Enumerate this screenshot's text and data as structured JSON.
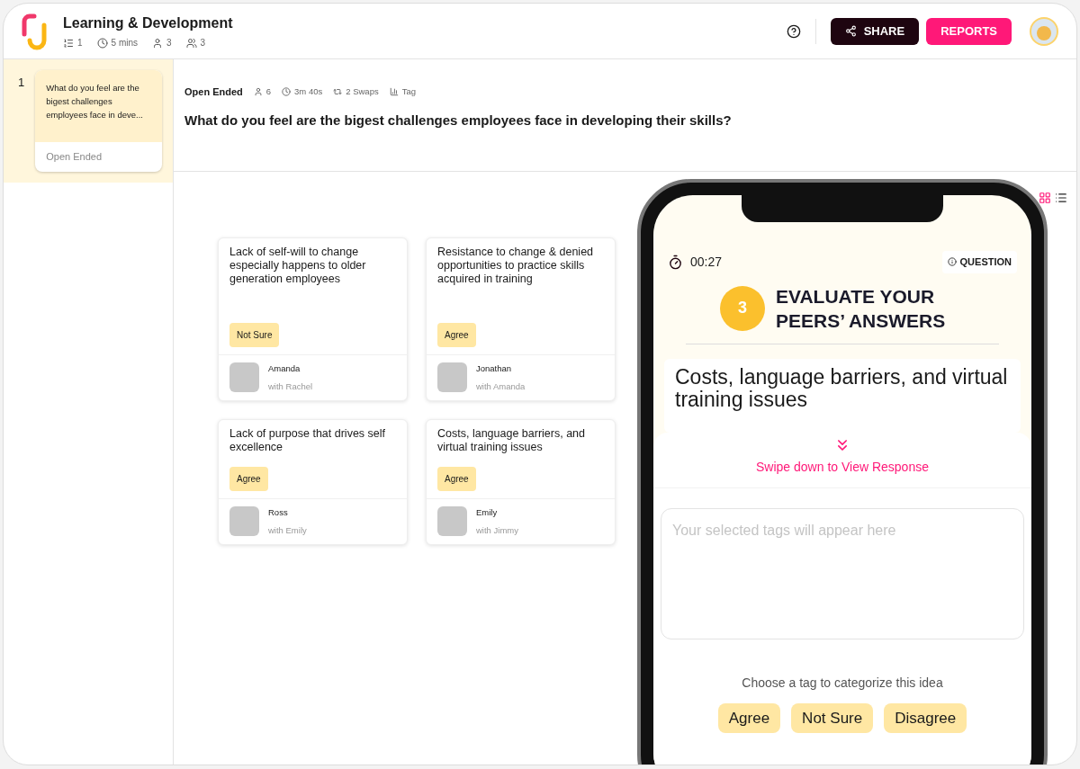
{
  "header": {
    "title": "Learning & Development",
    "stats": [
      {
        "kind": "questions",
        "text": "1"
      },
      {
        "kind": "duration",
        "text": "5 mins"
      },
      {
        "kind": "participants",
        "text": "3"
      },
      {
        "kind": "groups",
        "text": "3"
      }
    ],
    "share_label": "SHARE",
    "reports_label": "REPORTS"
  },
  "sidebar": {
    "items": [
      {
        "number": "1",
        "preview": "What do you feel are the bigest challenges employees face in deve...",
        "type": "Open Ended",
        "selected": true
      }
    ]
  },
  "question": {
    "type": "Open Ended",
    "meta": [
      {
        "kind": "participants",
        "text": "6"
      },
      {
        "kind": "duration",
        "text": "3m 40s"
      },
      {
        "kind": "swaps",
        "text": "2 Swaps"
      },
      {
        "kind": "tag",
        "text": "Tag"
      }
    ],
    "text": "What do you feel are the bigest challenges employees face in developing their skills?"
  },
  "view_toggle": [
    {
      "kind": "grid",
      "selected": true
    },
    {
      "kind": "list",
      "selected": false
    }
  ],
  "responses": [
    {
      "text": "Lack of self-will to change especially happens to older generation employees",
      "tag": "Not Sure",
      "author": "Amanda",
      "partner": "with Rachel"
    },
    {
      "text": "Resistance to change & denied opportunities to practice skills acquired in training",
      "tag": "Agree",
      "author": "Jonathan",
      "partner": "with Amanda"
    },
    {
      "text": "Lack of purpose that drives self excellence",
      "tag": "Agree",
      "author": "Ross",
      "partner": "with Emily"
    },
    {
      "text": "Costs, language barriers, and virtual training issues",
      "tag": "Agree",
      "author": "Emily",
      "partner": "with Jimmy"
    }
  ],
  "phone": {
    "timer": "00:27",
    "question_badge": "QUESTION",
    "step": "3",
    "step_title": "EVALUATE YOUR PEERS’ ANSWERS",
    "answer": "Costs, language barriers, and virtual training issues",
    "swipe_hint": "Swipe down to View Response",
    "tags_placeholder": "Your selected tags will appear here",
    "tag_prompt": "Choose a tag to categorize this idea",
    "tags": [
      "Agree",
      "Not Sure",
      "Disagree"
    ]
  }
}
